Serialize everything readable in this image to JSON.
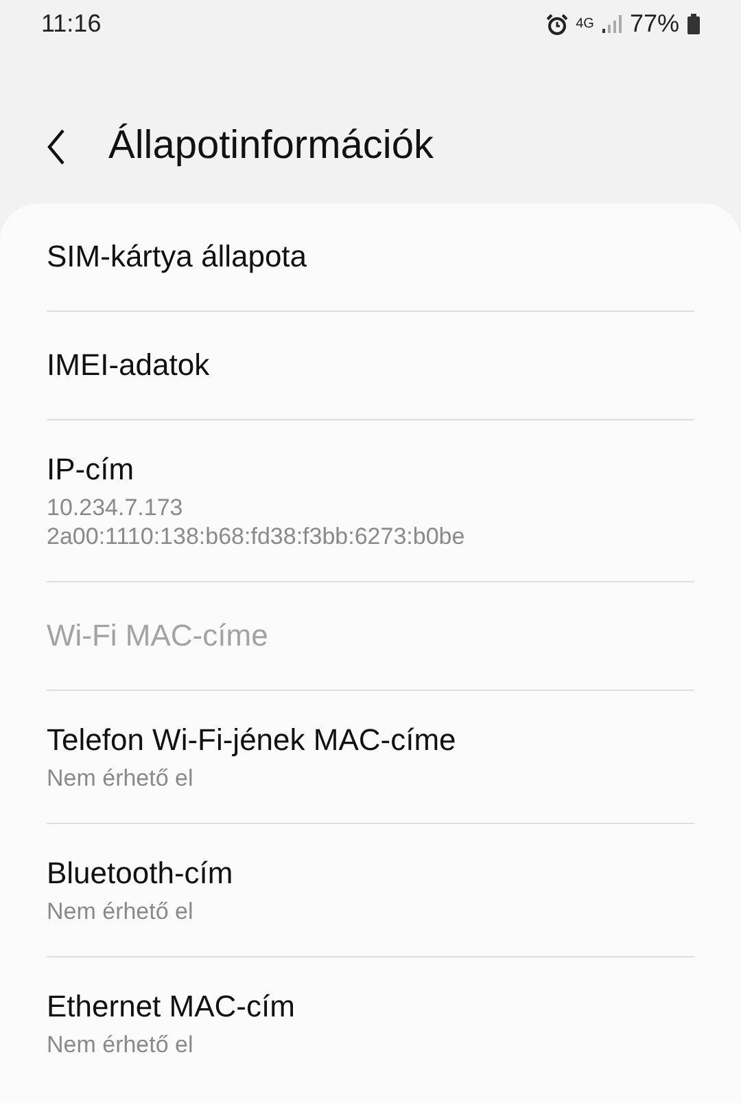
{
  "status_bar": {
    "time": "11:16",
    "network": "4G",
    "battery": "77%"
  },
  "header": {
    "title": "Állapotinformációk"
  },
  "items": [
    {
      "title": "SIM-kártya állapota",
      "disabled": false
    },
    {
      "title": "IMEI-adatok",
      "disabled": false
    },
    {
      "title": "IP-cím",
      "disabled": false,
      "details": [
        "10.234.7.173",
        "2a00:1110:138:b68:fd38:f3bb:6273:b0be"
      ]
    },
    {
      "title": "Wi-Fi MAC-címe",
      "disabled": true
    },
    {
      "title": "Telefon Wi-Fi-jének MAC-címe",
      "disabled": false,
      "details": [
        "Nem érhető el"
      ]
    },
    {
      "title": "Bluetooth-cím",
      "disabled": false,
      "details": [
        "Nem érhető el"
      ]
    },
    {
      "title": "Ethernet MAC-cím",
      "disabled": false,
      "details": [
        "Nem érhető el"
      ]
    }
  ]
}
